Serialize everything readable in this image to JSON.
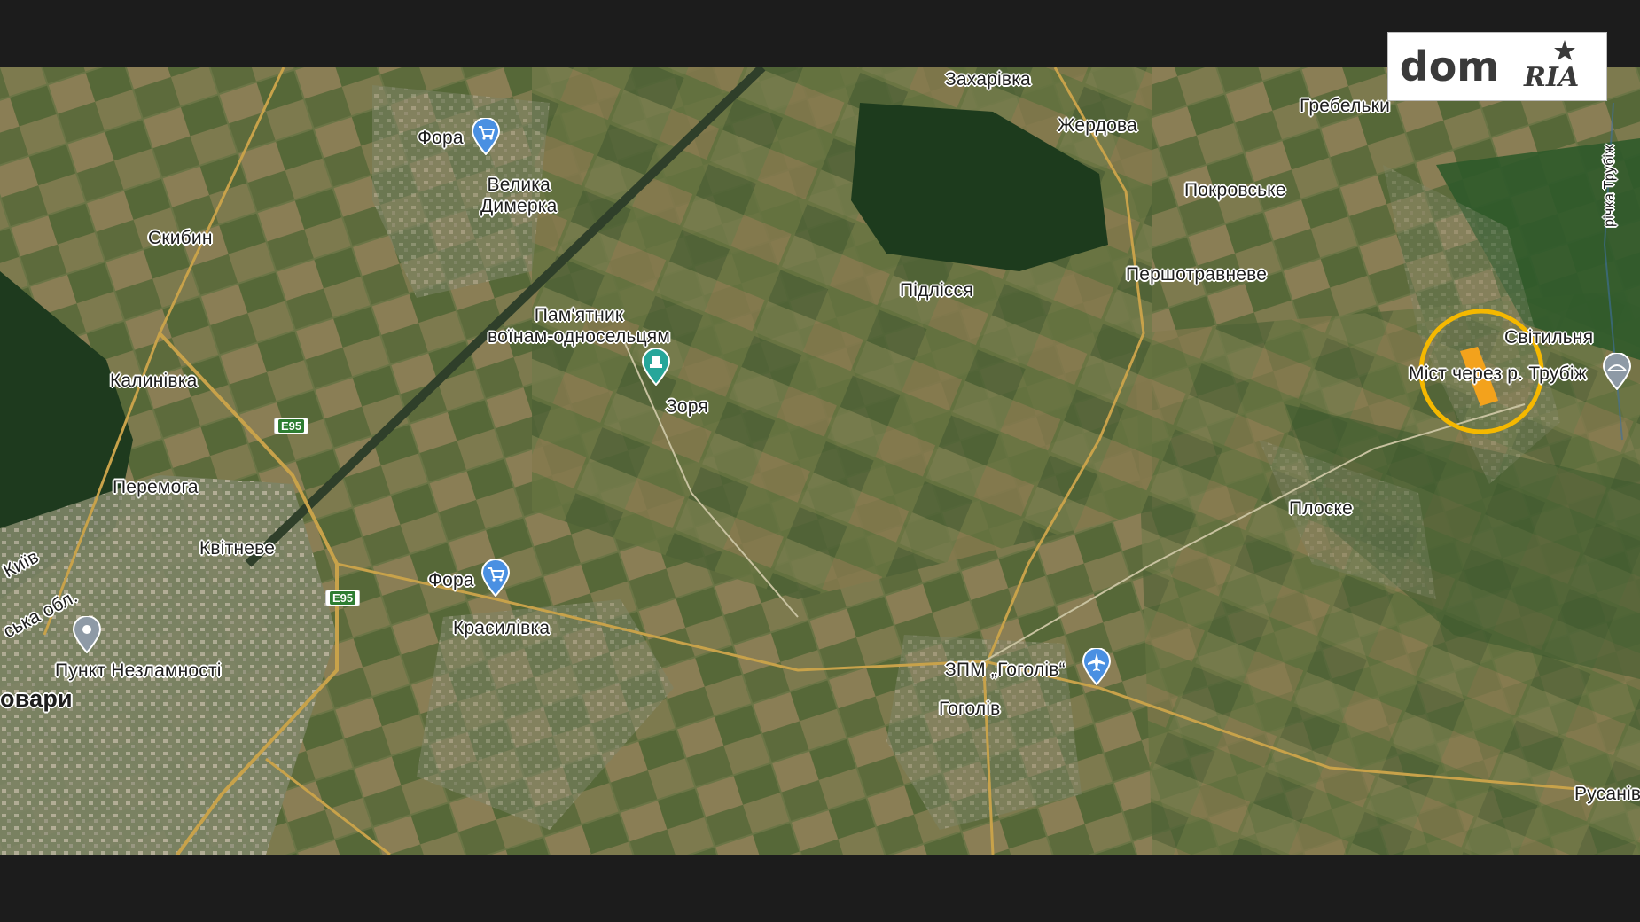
{
  "brand": {
    "dom": "dom",
    "ria": "RIA"
  },
  "labels": {
    "fora_top": "Фора",
    "velyka_dymerka": "Велика\nДимерка",
    "skybyn": "Скибин",
    "zakharivka": "Захарівка",
    "zherdova": "Жердова",
    "grebelky": "Гребельки",
    "pokrovske": "Покровське",
    "pidlissia": "Підлісся",
    "pershotravneve": "Першотравневе",
    "pamiatnyk": "Пам'ятник\nвоїнам-односельцям",
    "zoria": "Зоря",
    "kalynivka": "Калинівка",
    "svitylnia": "Світильня",
    "mist": "Міст через р. Трубіж",
    "richka": "річка Трубіж",
    "peremoga": "Перемога",
    "kvitneve": "Квітневе",
    "kyiv_edge": "Київ",
    "oblast_edge": "ська обл.",
    "fora_bottom": "Фора",
    "krasylivka": "Красилівка",
    "ploske": "Плоске",
    "punkt": "Пункт Незламності",
    "brovary": "овари",
    "zpm": "ЗПМ „Гоголів“",
    "gogoliv": "Гоголів",
    "rusaniv": "Русанів"
  },
  "roads": {
    "e95_a": "E95",
    "e95_b": "E95"
  },
  "icons": {
    "fora_top": "shopping-cart-pin",
    "fora_bottom": "shopping-cart-pin",
    "monument": "monument-pin",
    "punkt": "location-pin",
    "airport": "airplane-pin",
    "bridge": "bridge-pin"
  },
  "colors": {
    "marker": "#f5b800",
    "plot": "#f3a21c",
    "road": "#c8a24a",
    "forest": "#1e3a1e",
    "field": "#7a7a48",
    "highway_shield": "#2e7d32",
    "pin_blue": "#4a90e2",
    "pin_teal": "#26a69a",
    "pin_gray": "#8e9aa6"
  }
}
